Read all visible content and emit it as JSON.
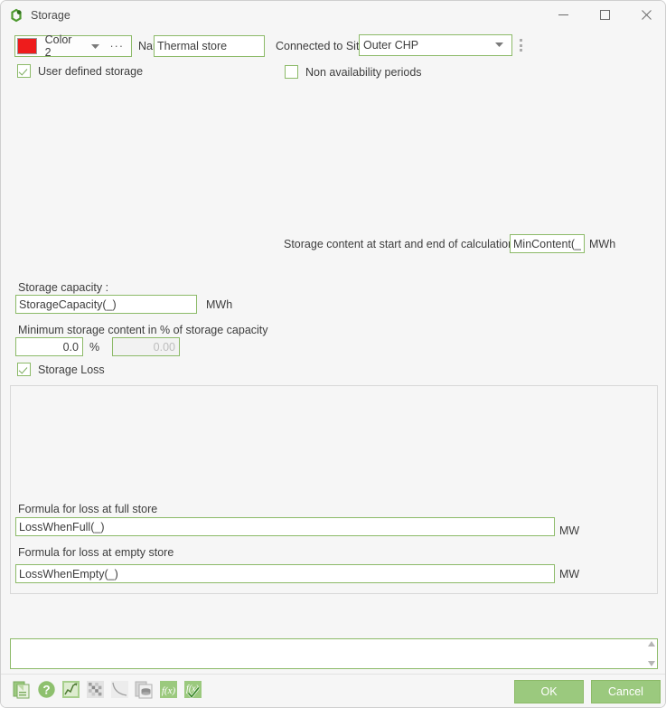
{
  "window": {
    "title": "Storage",
    "icon": "storage-ring-icon",
    "controls": {
      "minimize": "–",
      "maximize": "□",
      "close": "✕"
    }
  },
  "colors": {
    "accent_green": "#8cba68",
    "button_green": "#9bc97e",
    "swatch_red": "#ee1c1c",
    "window_bg": "#f6f6f6",
    "text": "#3d3d3d"
  },
  "top": {
    "color_picker": {
      "swatch_color": "#ee1c1c",
      "label": "Color 2",
      "dropdown_arrow": "▾",
      "more_button": "···"
    },
    "name_label": "Name:",
    "name_value": "Thermal store",
    "connected_label": "Connected to Site:",
    "connected_value": "Outer CHP",
    "connected_arrow": "▾",
    "user_defined_storage": {
      "label": "User defined storage",
      "checked": true
    },
    "non_availability_periods": {
      "label": "Non availability periods",
      "checked": false
    }
  },
  "content_start_end": {
    "label": "Storage content at start and end of calculation",
    "value": "MinContent(_)",
    "unit": "MWh"
  },
  "capacity": {
    "label": "Storage capacity :",
    "value": "StorageCapacity(_)",
    "unit": "MWh"
  },
  "minimum_content": {
    "label": "Minimum storage content in % of storage capacity",
    "percent_value": "0.0",
    "percent_unit": "%",
    "computed_value": "0.00"
  },
  "storage_loss": {
    "label": "Storage Loss",
    "checked": true
  },
  "loss_full": {
    "label": "Formula for loss at full store",
    "value": "LossWhenFull(_)",
    "unit": "MW"
  },
  "loss_empty": {
    "label": "Formula for loss at empty store",
    "value": "LossWhenEmpty(_)",
    "unit": "MW"
  },
  "notes": {
    "value": "",
    "placeholder": ""
  },
  "toolbar_icons": [
    {
      "name": "document-icon",
      "enabled": true
    },
    {
      "name": "help-question-icon",
      "enabled": true
    },
    {
      "name": "line-chart-icon",
      "enabled": true
    },
    {
      "name": "matrix-grid-icon",
      "enabled": false
    },
    {
      "name": "curve-icon",
      "enabled": false
    },
    {
      "name": "database-document-icon",
      "enabled": false
    },
    {
      "name": "function-fx-icon",
      "enabled": true
    },
    {
      "name": "function-fx-check-icon",
      "enabled": true
    }
  ],
  "buttons": {
    "ok": "OK",
    "cancel": "Cancel"
  }
}
